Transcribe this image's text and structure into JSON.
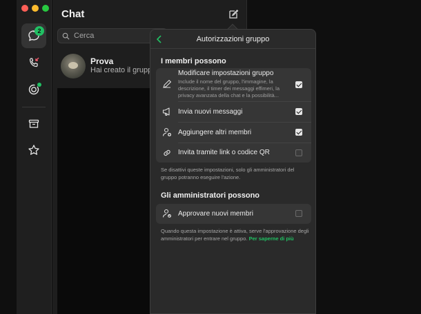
{
  "window": {
    "traffic_lights": [
      "close",
      "minimize",
      "zoom"
    ]
  },
  "rail": {
    "chats_badge": "2",
    "items": [
      {
        "name": "chats",
        "icon": "chat-bubble-icon"
      },
      {
        "name": "calls",
        "icon": "phone-missed-icon"
      },
      {
        "name": "status",
        "icon": "status-ring-icon"
      },
      {
        "name": "archived",
        "icon": "archive-icon"
      },
      {
        "name": "starred",
        "icon": "star-icon"
      }
    ]
  },
  "chatlist": {
    "title": "Chat",
    "search_placeholder": "Cerca",
    "chats": [
      {
        "name": "Prova",
        "preview": "Hai creato il gruppo"
      }
    ]
  },
  "panel": {
    "title": "Autorizzazioni gruppo",
    "members_section": "I membri possono",
    "items": [
      {
        "label": "Modificare impostazioni gruppo",
        "description": "Include il nome del gruppo, l'immagine, la descrizione, il timer dei messaggi effimeri, la privacy avanzata della chat e la possibilità...",
        "checked": true,
        "icon": "pencil-icon"
      },
      {
        "label": "Invia nuovi messaggi",
        "checked": true,
        "icon": "megaphone-icon"
      },
      {
        "label": "Aggiungere altri membri",
        "checked": true,
        "icon": "add-member-icon"
      },
      {
        "label": "Invita tramite link o codice QR",
        "checked": false,
        "icon": "link-icon"
      }
    ],
    "members_note": "Se disattivi queste impostazioni, solo gli amministratori del gruppo potranno eseguire l'azione.",
    "admins_section": "Gli amministratori possono",
    "admin_item": {
      "label": "Approvare nuovi membri",
      "checked": false,
      "icon": "approve-member-icon"
    },
    "admins_note": "Quando questa impostazione è attiva, serve l'approvazione degli amministratori per entrare nel gruppo.",
    "learn_more": "Per saperne di più"
  },
  "colors": {
    "accent": "#21c063",
    "panel_bg": "#2a2a2a",
    "group_bg": "#363636"
  }
}
